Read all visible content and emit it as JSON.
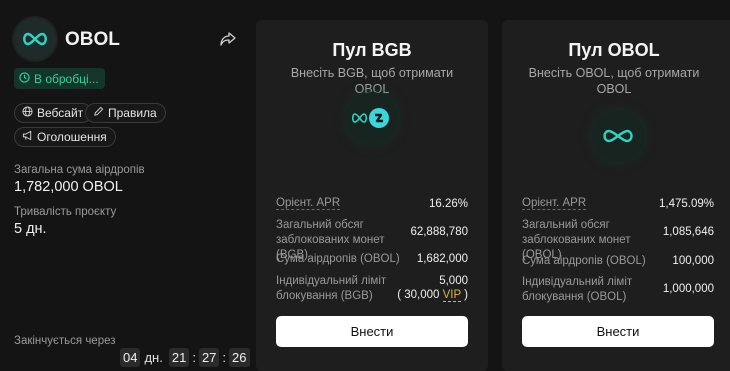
{
  "token": {
    "name": "OBOL",
    "status": "В обробці..."
  },
  "links": {
    "website": "Вебсайт",
    "rules": "Правила",
    "announcements": "Оголошення"
  },
  "stats": {
    "total_airdrop_label": "Загальна сума аірдропів",
    "total_airdrop_value": "1,782,000 OBOL",
    "duration_label": "Тривалість проєкту",
    "duration_value": "5 дн."
  },
  "countdown": {
    "label": "Закінчується через",
    "days": "04",
    "days_unit": "дн.",
    "hours": "21",
    "minutes": "27",
    "seconds": "26",
    "sep": ":"
  },
  "pools": [
    {
      "title": "Пул BGB",
      "subtitle": "Внесіть BGB, щоб отримати OBOL",
      "apr_label": "Орієнт. APR",
      "apr_value": "16.26%",
      "locked_label": "Загальний обсяг заблокованих монет (BGB)",
      "locked_value": "62,888,780",
      "airdrop_label": "Сума аірдропів (OBOL)",
      "airdrop_value": "1,682,000",
      "limit_label": "Індивідуальний ліміт блокування (BGB)",
      "limit_value": "5,000",
      "limit_vip_open": "( 30,000 ",
      "limit_vip_tag": "VIP",
      "limit_vip_close": " )",
      "button": "Внести"
    },
    {
      "title": "Пул OBOL",
      "subtitle": "Внесіть OBOL, щоб отримати OBOL",
      "apr_label": "Орієнт. APR",
      "apr_value": "1,475.09%",
      "locked_label": "Загальний обсяг заблокованих монет (OBOL)",
      "locked_value": "1,085,646",
      "airdrop_label": "Сума аірдропів (OBOL)",
      "airdrop_value": "100,000",
      "limit_label": "Індивідуальний ліміт блокування (OBOL)",
      "limit_value": "1,000,000",
      "button": "Внести"
    }
  ],
  "colors": {
    "accent": "#2ed3a0",
    "vip": "#e0b33b",
    "card_bg": "#1e1e1e",
    "page_bg": "#141414"
  },
  "icons": {
    "token_logo": "obol-infinity-icon",
    "share": "share-icon",
    "status": "clock-icon",
    "website": "globe-icon",
    "rules": "pencil-icon",
    "announcements": "megaphone-icon",
    "bgb_pool": "bgb-swap-icon",
    "obol_pool": "obol-infinity-icon"
  }
}
